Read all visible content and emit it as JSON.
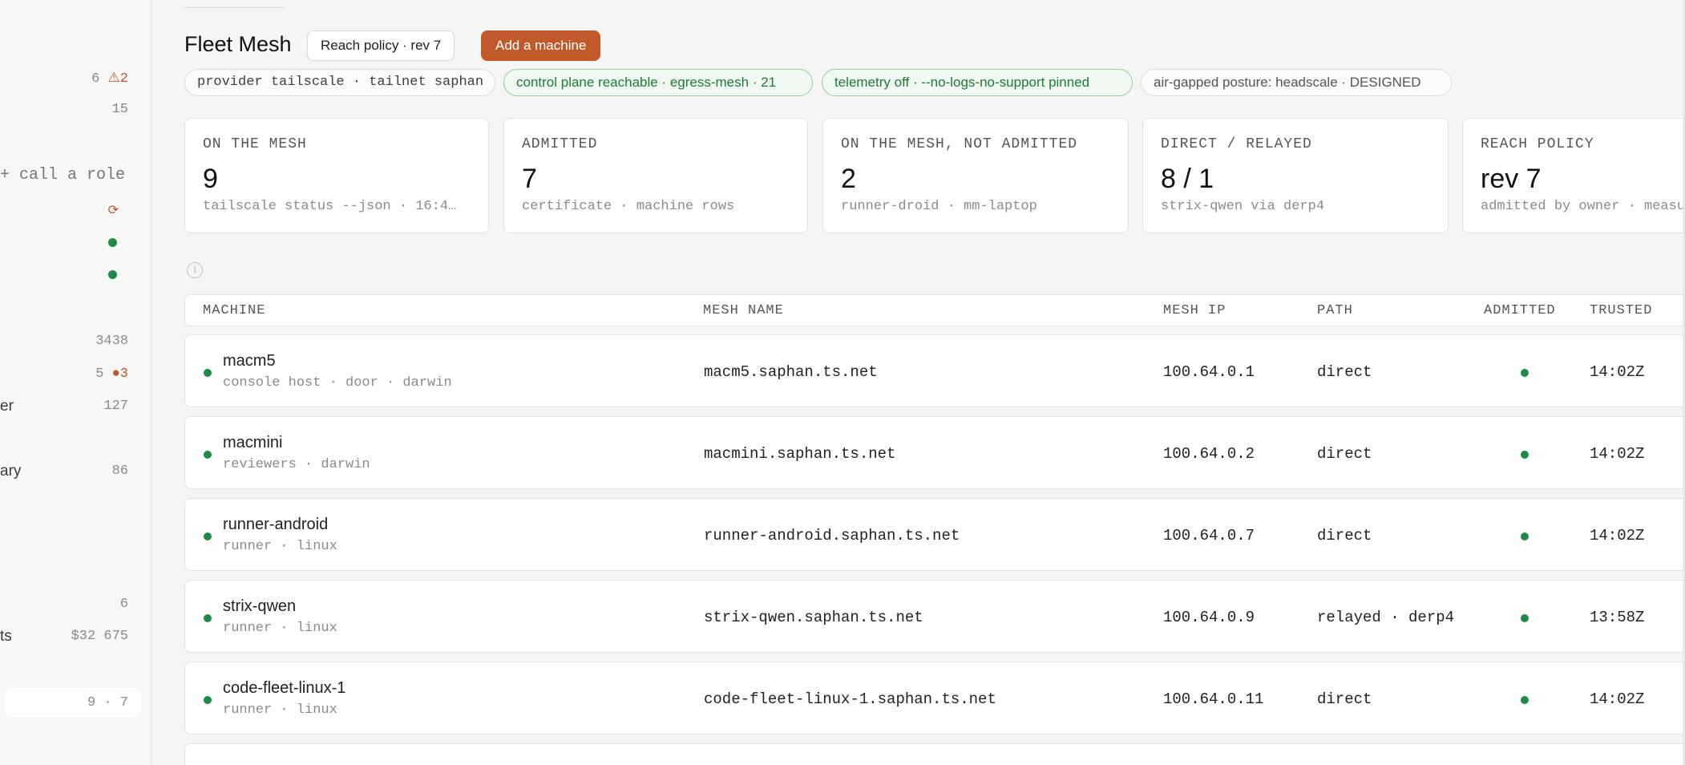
{
  "sidebar": {
    "rows": [
      {
        "label": "",
        "value": "6 ",
        "warn": "⚠2",
        "kind": "val"
      },
      {
        "label": "",
        "value": "15",
        "warn": "",
        "kind": "val"
      },
      {
        "label": "",
        "value": "",
        "warn": "",
        "kind": "ring"
      },
      {
        "label": "",
        "value": "",
        "warn": "",
        "kind": "dot"
      },
      {
        "label": "",
        "value": "",
        "warn": "",
        "kind": "dot"
      },
      {
        "label": "",
        "value": "3438",
        "warn": "",
        "kind": "val"
      },
      {
        "label": "",
        "value": "5 ",
        "warn": "●3",
        "kind": "val"
      },
      {
        "label": "er",
        "value": "127",
        "warn": "",
        "kind": "val"
      },
      {
        "label": "ary",
        "value": "86",
        "warn": "",
        "kind": "val"
      },
      {
        "label": "",
        "value": "6",
        "warn": "",
        "kind": "val"
      },
      {
        "label": "ts",
        "value": "$32 675",
        "warn": "",
        "kind": "val"
      }
    ],
    "call_role": "+ call a role",
    "pill_value": "9 · 7"
  },
  "header": {
    "title": "Fleet Mesh",
    "policy_button": "Reach policy · rev 7",
    "add_button": "Add a machine"
  },
  "chips": [
    {
      "text": "provider tailscale · tailnet saphan",
      "style": "plain"
    },
    {
      "text": "control plane reachable · egress-mesh · 21",
      "style": "green"
    },
    {
      "text": "telemetry off · --no-logs-no-support pinned",
      "style": "green"
    },
    {
      "text": "air-gapped posture: headscale · DESIGNED",
      "style": "gray"
    }
  ],
  "stats": [
    {
      "label": "ON THE MESH",
      "value": "9",
      "sub": "tailscale status --json · 16:4…"
    },
    {
      "label": "ADMITTED",
      "value": "7",
      "sub": "certificate · machine rows"
    },
    {
      "label": "ON THE MESH, NOT ADMITTED",
      "value": "2",
      "sub": "runner-droid · mm-laptop"
    },
    {
      "label": "DIRECT / RELAYED",
      "value": "8 / 1",
      "sub": "strix-qwen via derp4"
    },
    {
      "label": "REACH POLICY",
      "value": "rev 7",
      "sub": "admitted by owner · measured"
    }
  ],
  "table": {
    "columns": [
      "MACHINE",
      "MESH NAME",
      "MESH IP",
      "PATH",
      "ADMITTED",
      "TRUSTED"
    ],
    "rows": [
      {
        "name": "macm5",
        "sub": "console host · door · darwin",
        "mesh_name": "macm5.saphan.ts.net",
        "ip": "100.64.0.1",
        "path": "direct",
        "trusted": "14:02Z"
      },
      {
        "name": "macmini",
        "sub": "reviewers · darwin",
        "mesh_name": "macmini.saphan.ts.net",
        "ip": "100.64.0.2",
        "path": "direct",
        "trusted": "14:02Z"
      },
      {
        "name": "runner-android",
        "sub": "runner · linux",
        "mesh_name": "runner-android.saphan.ts.net",
        "ip": "100.64.0.7",
        "path": "direct",
        "trusted": "14:02Z"
      },
      {
        "name": "strix-qwen",
        "sub": "runner · linux",
        "mesh_name": "strix-qwen.saphan.ts.net",
        "ip": "100.64.0.9",
        "path": "relayed · derp4",
        "trusted": "13:58Z"
      },
      {
        "name": "code-fleet-linux-1",
        "sub": "runner · linux",
        "mesh_name": "code-fleet-linux-1.saphan.ts.net",
        "ip": "100.64.0.11",
        "path": "direct",
        "trusted": "14:02Z"
      }
    ]
  },
  "colors": {
    "accent": "#c2592b",
    "ok": "#1e8a44",
    "warn": "#c0552a"
  }
}
